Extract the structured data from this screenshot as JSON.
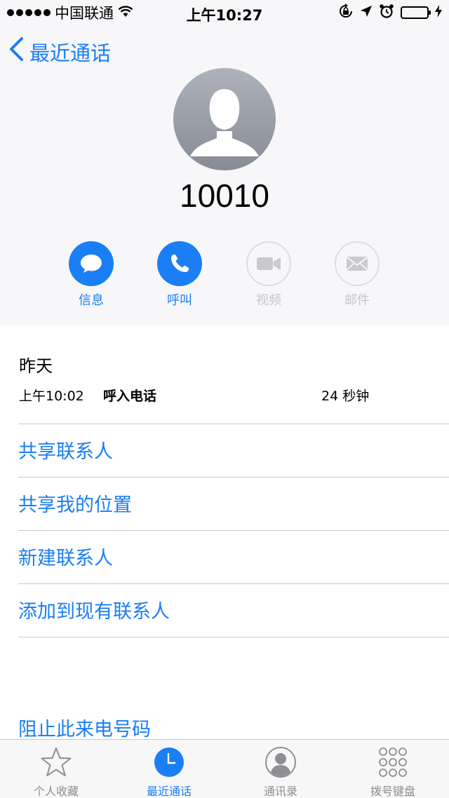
{
  "status_bar": {
    "carrier": "中国联通",
    "time": "上午10:27"
  },
  "nav": {
    "back_label": "最近通话"
  },
  "contact": {
    "number": "10010"
  },
  "actions": [
    {
      "label": "信息",
      "icon": "message-icon",
      "enabled": true
    },
    {
      "label": "呼叫",
      "icon": "phone-icon",
      "enabled": true
    },
    {
      "label": "视频",
      "icon": "video-icon",
      "enabled": false
    },
    {
      "label": "邮件",
      "icon": "mail-icon",
      "enabled": false
    }
  ],
  "call_log": {
    "day": "昨天",
    "entries": [
      {
        "time": "上午10:02",
        "type": "呼入电话",
        "duration": "24 秒钟"
      }
    ]
  },
  "menu": {
    "share_contact": "共享联系人",
    "share_location": "共享我的位置",
    "new_contact": "新建联系人",
    "add_existing": "添加到现有联系人",
    "block": "阻止此来电号码"
  },
  "tabs": [
    {
      "label": "个人收藏",
      "icon": "star-icon",
      "selected": false
    },
    {
      "label": "最近通话",
      "icon": "clock-icon",
      "selected": true
    },
    {
      "label": "通讯录",
      "icon": "contacts-icon",
      "selected": false
    },
    {
      "label": "拨号键盘",
      "icon": "keypad-icon",
      "selected": false
    }
  ],
  "colors": {
    "accent": "#1a7ef5",
    "battery": "#4cd964",
    "disabled": "#c5c6cb"
  }
}
